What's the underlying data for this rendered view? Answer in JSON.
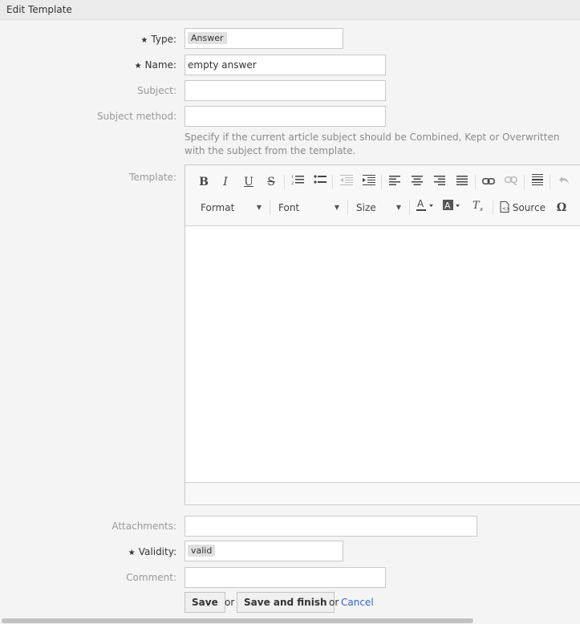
{
  "header": {
    "title": "Edit Template"
  },
  "form": {
    "type": {
      "label": "Type:",
      "value": "Answer",
      "required": true
    },
    "name": {
      "label": "Name:",
      "value": "empty answer",
      "required": true
    },
    "subject": {
      "label": "Subject:",
      "value": ""
    },
    "subject_method": {
      "label": "Subject method:",
      "value": "",
      "hint": "Specify if the current article subject should be Combined, Kept or Overwritten with the subject from the template."
    },
    "template": {
      "label": "Template:"
    },
    "attachments": {
      "label": "Attachments:",
      "value": ""
    },
    "validity": {
      "label": "Validity:",
      "value": "valid",
      "required": true
    },
    "comment": {
      "label": "Comment:",
      "value": ""
    },
    "required_marker": "★"
  },
  "editor": {
    "toolbar_row1": [
      {
        "name": "bold-button",
        "glyph": "B"
      },
      {
        "name": "italic-button",
        "glyph": "I"
      },
      {
        "name": "underline-button",
        "glyph": "U"
      },
      {
        "name": "strikethrough-button",
        "glyph": "S"
      },
      {
        "name": "numbered-list-button",
        "icon": "numbered-list-icon"
      },
      {
        "name": "bulleted-list-button",
        "icon": "bulleted-list-icon"
      },
      {
        "name": "decrease-indent-button",
        "icon": "outdent-icon"
      },
      {
        "name": "increase-indent-button",
        "icon": "indent-icon"
      },
      {
        "name": "align-left-button",
        "icon": "align-left-icon"
      },
      {
        "name": "align-center-button",
        "icon": "align-center-icon"
      },
      {
        "name": "align-right-button",
        "icon": "align-right-icon"
      },
      {
        "name": "justify-button",
        "icon": "justify-icon"
      },
      {
        "name": "link-button",
        "icon": "link-icon"
      },
      {
        "name": "unlink-button",
        "icon": "unlink-icon"
      },
      {
        "name": "horizontal-line-button",
        "icon": "horizontal-line-icon"
      },
      {
        "name": "undo-button",
        "icon": "undo-icon"
      }
    ],
    "format_label": "Format",
    "font_label": "Font",
    "size_label": "Size",
    "source_label": "Source",
    "special_char_glyph": "Ω"
  },
  "actions": {
    "save_label": "Save",
    "or1": "or",
    "save_finish_label": "Save and finish",
    "or2": "or",
    "cancel_label": "Cancel"
  }
}
